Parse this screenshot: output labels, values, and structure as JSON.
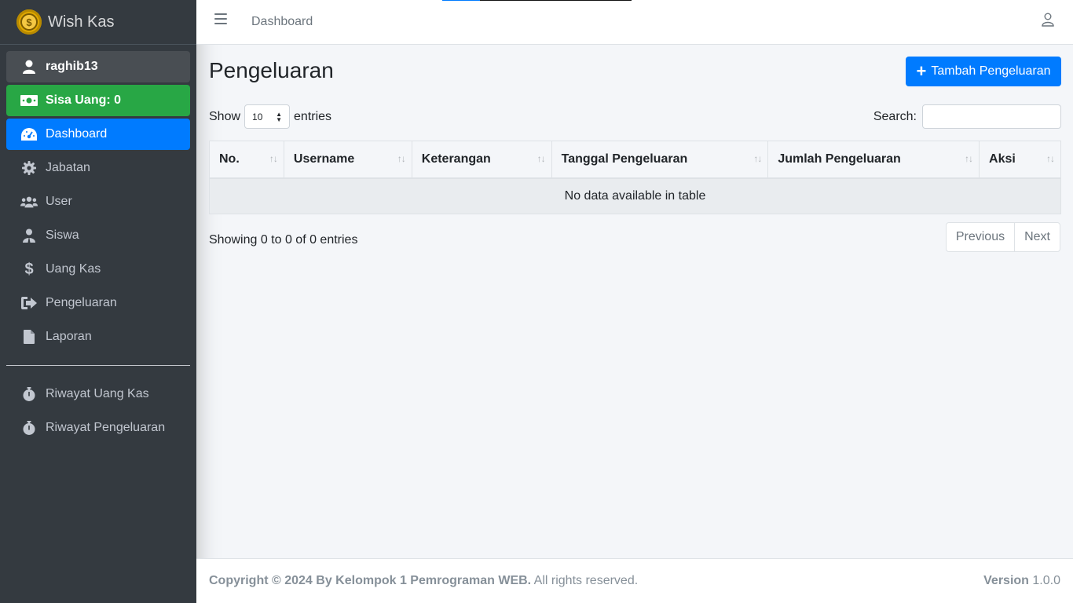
{
  "brand": {
    "name": "Wish Kas",
    "logo_glyph": "$"
  },
  "sidebar": {
    "user": "raghib13",
    "balance": "Sisa Uang: 0",
    "items": [
      {
        "label": "Dashboard",
        "icon": "tachometer-icon"
      },
      {
        "label": "Jabatan",
        "icon": "gear-icon"
      },
      {
        "label": "User",
        "icon": "users-icon"
      },
      {
        "label": "Siswa",
        "icon": "student-icon"
      },
      {
        "label": "Uang Kas",
        "icon": "dollar-icon"
      },
      {
        "label": "Pengeluaran",
        "icon": "sign-out-icon"
      },
      {
        "label": "Laporan",
        "icon": "file-icon"
      }
    ],
    "history": [
      {
        "label": "Riwayat Uang Kas",
        "icon": "stopwatch-icon"
      },
      {
        "label": "Riwayat Pengeluaran",
        "icon": "stopwatch-icon"
      }
    ]
  },
  "navbar": {
    "link": "Dashboard"
  },
  "main": {
    "title": "Pengeluaran",
    "add_button": "Tambah Pengeluaran",
    "show_label": "Show",
    "entries_label": "entries",
    "page_size": "10",
    "search_label": "Search:",
    "search_value": "",
    "columns": [
      "No.",
      "Username",
      "Keterangan",
      "Tanggal Pengeluaran",
      "Jumlah Pengeluaran",
      "Aksi"
    ],
    "sort_glyph": "↑↓",
    "empty_message": "No data available in table",
    "info": "Showing 0 to 0 of 0 entries",
    "prev": "Previous",
    "next": "Next"
  },
  "footer": {
    "copyright_bold": "Copyright © 2024 By Kelompok 1 Pemrograman WEB.",
    "copyright_rest": "All rights reserved.",
    "version_label": "Version",
    "version_value": "1.0.0"
  },
  "colors": {
    "sidebar": "#343a40",
    "primary": "#007bff",
    "success": "#28a745",
    "background": "#f4f6f9"
  }
}
